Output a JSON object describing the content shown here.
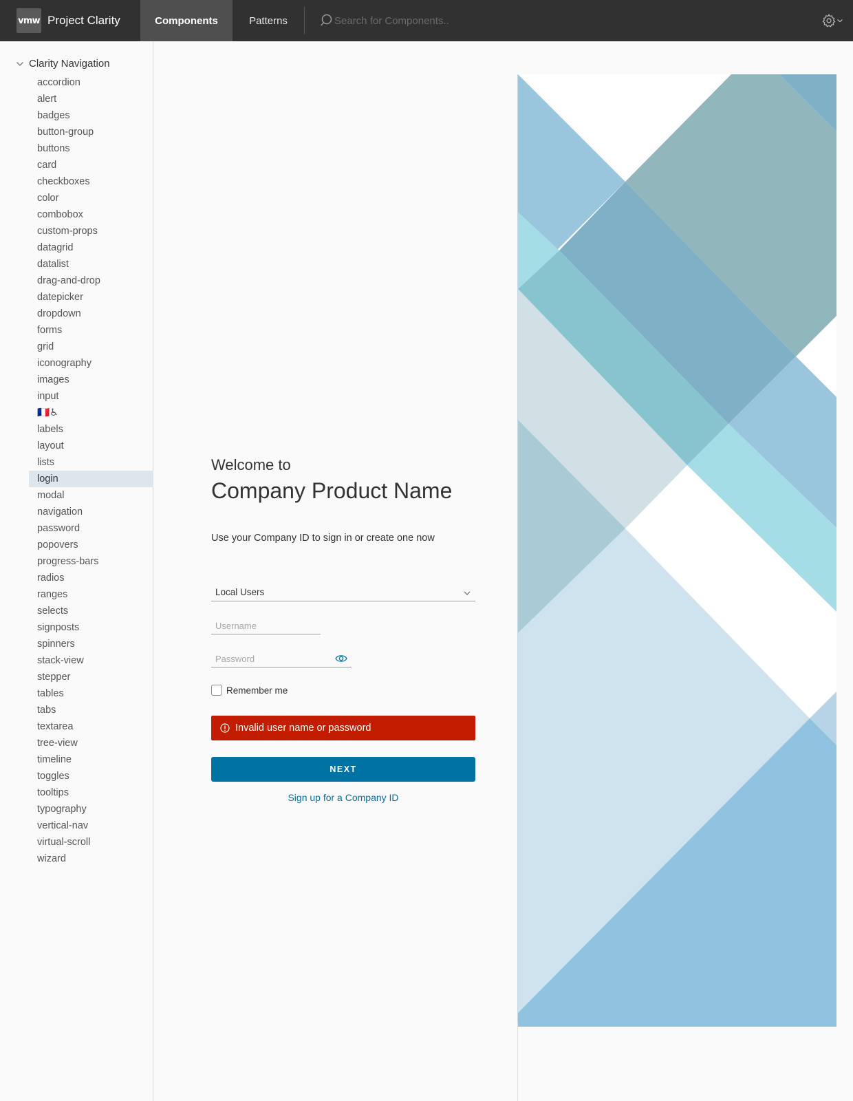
{
  "header": {
    "logo_text": "vmw",
    "title": "Project Clarity",
    "tabs": [
      {
        "label": "Components",
        "active": true
      },
      {
        "label": "Patterns",
        "active": false
      }
    ],
    "search_placeholder": "Search for Components..",
    "settings_icon": "gear-icon"
  },
  "sidebar": {
    "root_label": "Clarity Navigation",
    "items": [
      "accordion",
      "alert",
      "badges",
      "button-group",
      "buttons",
      "card",
      "checkboxes",
      "color",
      "combobox",
      "custom-props",
      "datagrid",
      "datalist",
      "drag-and-drop",
      "datepicker",
      "dropdown",
      "forms",
      "grid",
      "iconography",
      "images",
      "input",
      "🇫🇷♿",
      "labels",
      "layout",
      "lists",
      "login",
      "modal",
      "navigation",
      "password",
      "popovers",
      "progress-bars",
      "radios",
      "ranges",
      "selects",
      "signposts",
      "spinners",
      "stack-view",
      "stepper",
      "tables",
      "tabs",
      "textarea",
      "tree-view",
      "timeline",
      "toggles",
      "tooltips",
      "typography",
      "vertical-nav",
      "virtual-scroll",
      "wizard"
    ],
    "active_item": "login"
  },
  "login": {
    "welcome": "Welcome to",
    "product": "Company Product Name",
    "subtitle": "Use your Company ID to sign in or create one now",
    "auth_source": "Local Users",
    "username_placeholder": "Username",
    "password_placeholder": "Password",
    "remember_label": "Remember me",
    "error_message": "Invalid user name or password",
    "next_label": "NEXT",
    "signup_label": "Sign up for a Company ID"
  },
  "colors": {
    "header_bg": "#313131",
    "primary": "#0072a3",
    "danger": "#c21d00",
    "active_nav_bg": "#dde6ec"
  }
}
